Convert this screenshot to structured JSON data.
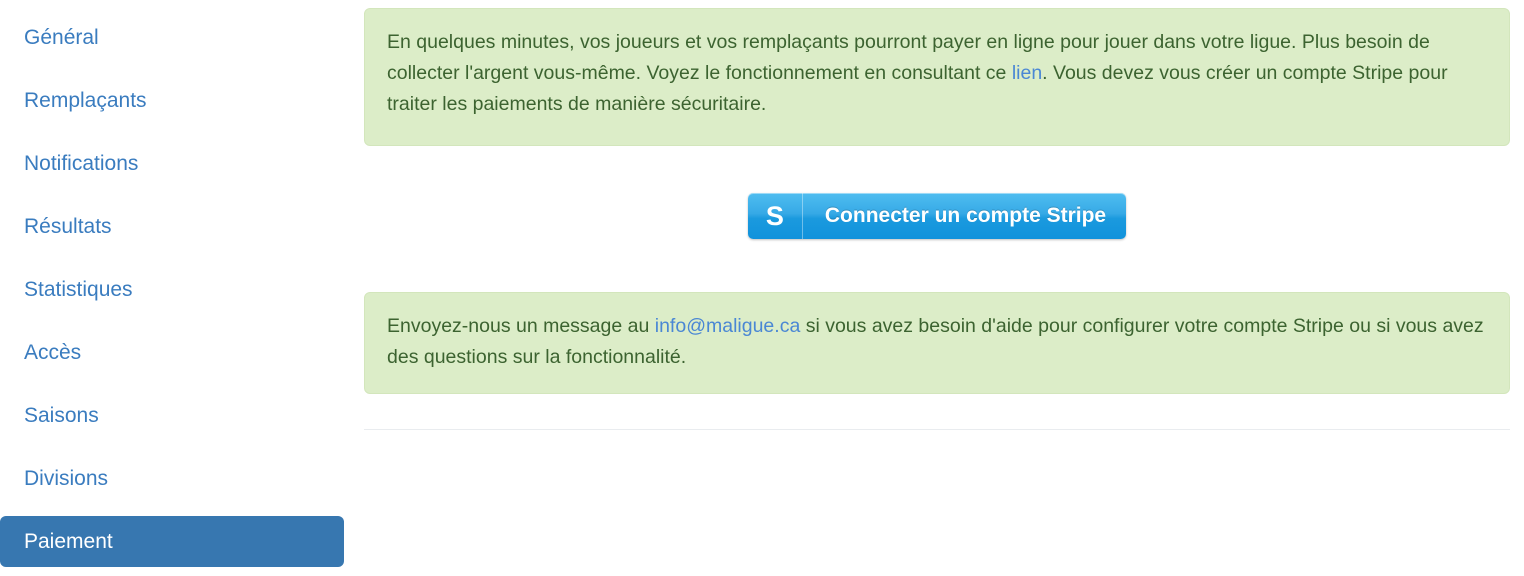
{
  "sidebar": {
    "items": [
      {
        "label": "Général",
        "active": false
      },
      {
        "label": "Remplaçants",
        "active": false
      },
      {
        "label": "Notifications",
        "active": false
      },
      {
        "label": "Résultats",
        "active": false
      },
      {
        "label": "Statistiques",
        "active": false
      },
      {
        "label": "Accès",
        "active": false
      },
      {
        "label": "Saisons",
        "active": false
      },
      {
        "label": "Divisions",
        "active": false
      },
      {
        "label": "Paiement",
        "active": true
      }
    ]
  },
  "main": {
    "alert_intro": {
      "part1": "En quelques minutes, vos joueurs et vos remplaçants pourront payer en ligne pour jouer dans votre ligue. Plus besoin de collecter l'argent vous-même. Voyez le fonctionnement en consultant ce ",
      "link_text": "lien",
      "part2": ". Vous devez vous créer un compte Stripe pour traiter les paiements de manière sécuritaire."
    },
    "stripe_button": {
      "logo_glyph": "S",
      "label": "Connecter un compte Stripe"
    },
    "alert_help": {
      "part1": "Envoyez-nous un message au ",
      "link_text": "info@maligue.ca",
      "part2": " si vous avez besoin d'aide pour configurer votre compte Stripe ou si vous avez des questions sur la fonctionnalité."
    }
  },
  "colors": {
    "link": "#4a87d4",
    "nav_link": "#3a7cbf",
    "nav_active_bg": "#3777b0",
    "alert_bg": "#dcedc8",
    "alert_text": "#3c6330",
    "stripe_blue": "#1b9ade",
    "divider": "#e9ecef"
  }
}
